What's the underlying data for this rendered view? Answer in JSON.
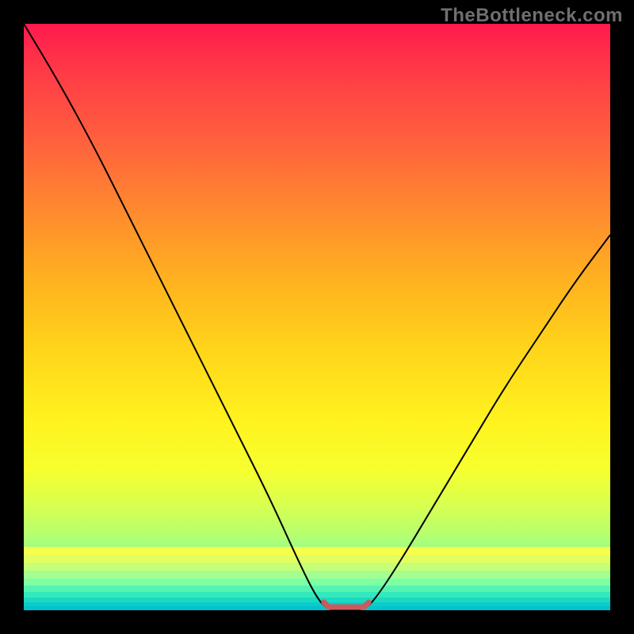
{
  "watermark": "TheBottleneck.com",
  "chart_data": {
    "type": "line",
    "title": "",
    "xlabel": "",
    "ylabel": "",
    "xlim": [
      0,
      100
    ],
    "ylim": [
      0,
      100
    ],
    "series": [
      {
        "name": "curve",
        "x": [
          0,
          6,
          12,
          18,
          24,
          30,
          36,
          42,
          47,
          50,
          52,
          54,
          58,
          60,
          64,
          70,
          76,
          82,
          88,
          94,
          100
        ],
        "values": [
          100,
          90,
          79,
          67,
          55,
          43,
          31,
          19,
          8,
          2,
          0,
          0,
          0,
          2,
          8,
          18,
          28,
          38,
          47,
          56,
          64
        ]
      }
    ],
    "flat_bottom_range_x": [
      52,
      58
    ],
    "background_gradient": {
      "orientation": "vertical",
      "stops": [
        {
          "pos": 0.0,
          "color": "#ff1a4d"
        },
        {
          "pos": 0.3,
          "color": "#ff8030"
        },
        {
          "pos": 0.55,
          "color": "#ffd61a"
        },
        {
          "pos": 0.75,
          "color": "#f7ff2f"
        },
        {
          "pos": 0.9,
          "color": "#8dff8d"
        },
        {
          "pos": 1.0,
          "color": "#00c2cf"
        }
      ]
    },
    "curve_style": {
      "stroke": "#000000",
      "width": 2
    },
    "bottom_marker_style": {
      "stroke": "#cc5a5a",
      "width": 7,
      "cap": "round"
    }
  }
}
